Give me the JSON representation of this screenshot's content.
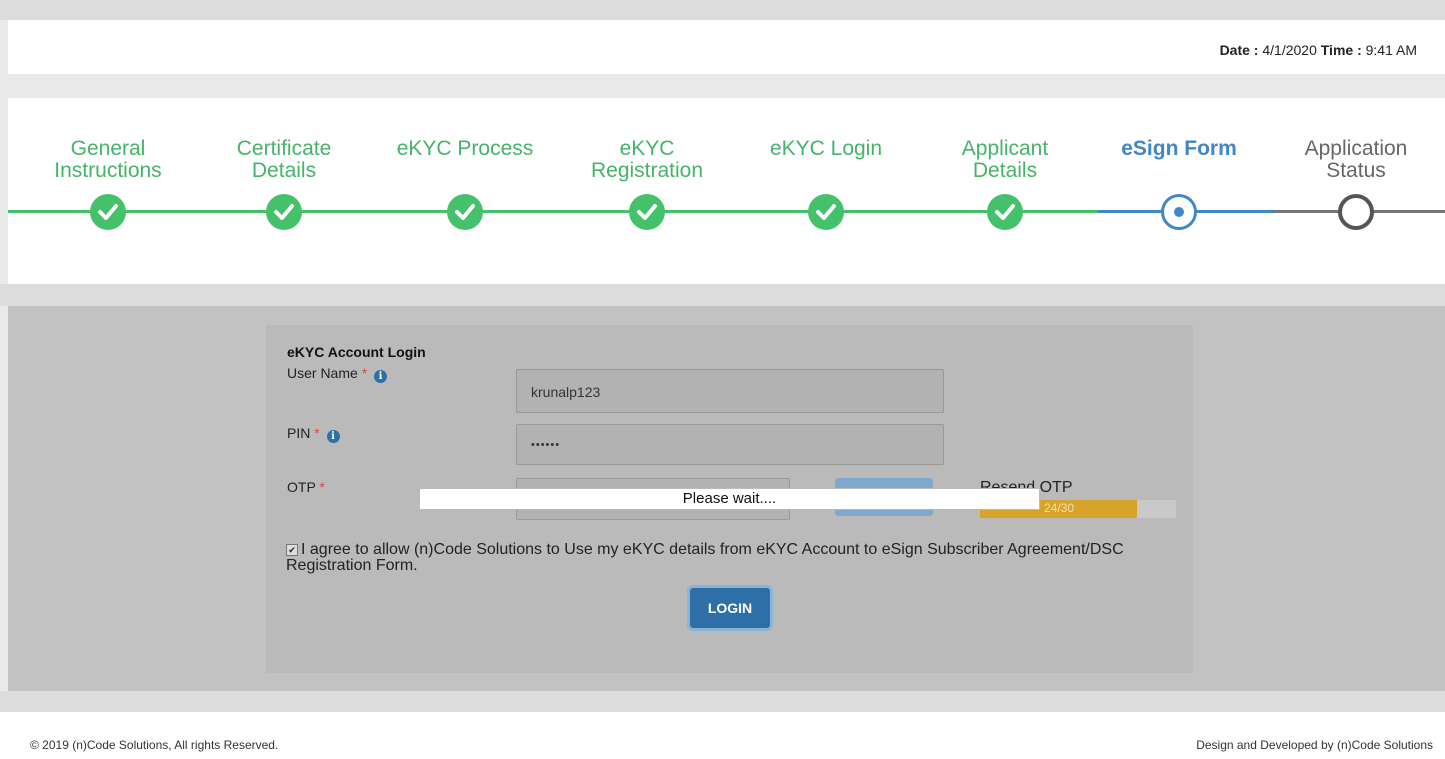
{
  "header": {
    "date_label": "Date :",
    "date_value": "4/1/2020",
    "time_label": "Time :",
    "time_value": "9:41 AM"
  },
  "steps": [
    {
      "line1": "General",
      "line2": "Instructions",
      "state": "done"
    },
    {
      "line1": "Certificate",
      "line2": "Details",
      "state": "done"
    },
    {
      "line1": "eKYC Process",
      "line2": "",
      "state": "done"
    },
    {
      "line1": "eKYC",
      "line2": "Registration",
      "state": "done"
    },
    {
      "line1": "eKYC Login",
      "line2": "",
      "state": "done"
    },
    {
      "line1": "Applicant",
      "line2": "Details",
      "state": "done"
    },
    {
      "line1": "eSign Form",
      "line2": "",
      "state": "active"
    },
    {
      "line1": "Application",
      "line2": "Status",
      "state": "todo"
    }
  ],
  "colors": {
    "done": "#45c16b",
    "active": "#3f87c7",
    "todo": "#555555",
    "timer": "#d8a32a"
  },
  "login": {
    "title": "eKYC Account Login",
    "username_label": "User Name",
    "username_value": "krunalp123",
    "pin_label": "PIN",
    "pin_value": "••••••",
    "otp_label": "OTP",
    "required_mark": "*",
    "info_glyph": "i",
    "resend_label": "Resend OTP",
    "timer_text": "24/30",
    "timer_fraction": 0.8,
    "wait_message": "Please wait....",
    "agree_checked_glyph": "✔",
    "agree_text": "I agree to allow (n)Code Solutions to Use my eKYC details from eKYC Account to eSign Subscriber Agreement/DSC Registration Form.",
    "login_button": "LOGIN"
  },
  "footer": {
    "copyright": "© 2019 (n)Code Solutions, All rights Reserved.",
    "credit": "Design and Developed by (n)Code Solutions"
  }
}
